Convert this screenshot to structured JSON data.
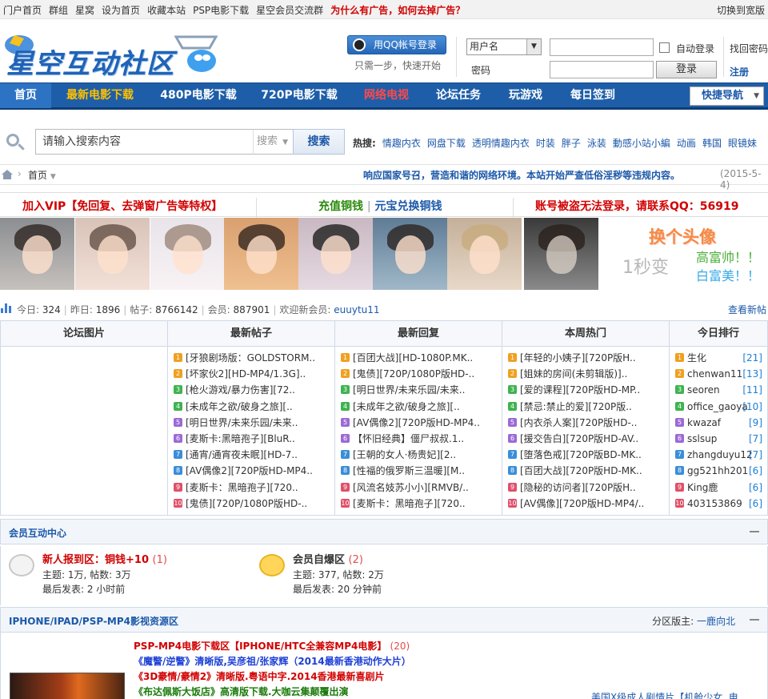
{
  "topbar": {
    "links": [
      "门户首页",
      "群组",
      "星窝",
      "设为首页",
      "收藏本站",
      "PSP电影下载",
      "星空会员交流群"
    ],
    "ad_question": "为什么有广告，如何去掉广告？",
    "wide_switch": "切换到宽版"
  },
  "header": {
    "logo_text": "星空互动社区",
    "qq_login": "用QQ帐号登录",
    "qq_note": "只需一步，快速开始",
    "username_select": "用户名",
    "password_label": "密码",
    "auto_login": "自动登录",
    "login_button": "登录",
    "find_password": "找回密码",
    "register": "注册"
  },
  "nav": {
    "items": [
      "首页",
      "最新电影下载",
      "480P电影下载",
      "720P电影下载",
      "网络电视",
      "论坛任务",
      "玩游戏",
      "每日签到"
    ],
    "quick": "快捷导航"
  },
  "search": {
    "placeholder": "请输入搜索内容",
    "type": "搜索",
    "button": "搜索",
    "hot_label": "热搜:",
    "hot_terms": [
      "情趣内衣",
      "网盘下载",
      "透明情趣内衣",
      "时装",
      "胖子",
      "泳装",
      "動感小站小編",
      "动画",
      "韩国",
      "眼镜妹"
    ]
  },
  "breadcrumb": {
    "current": "首页",
    "notice": "响应国家号召，营造和谐的网络环境。本站开始严查低俗淫秽等违规内容。",
    "date": "(2015-5-4)"
  },
  "banners": {
    "vip": "加入VIP【免回复、去弹窗广告等特权】",
    "recharge": "充值铜钱",
    "exchange": "元宝兑换铜钱",
    "stolen": "账号被盗无法登录，请联系QQ：56919"
  },
  "avatar_ad": {
    "title": "换个头像",
    "sub": "1秒变",
    "line1": "高富帅！！",
    "line2": "白富美！！"
  },
  "stats": {
    "today_label": "今日:",
    "today": "324",
    "yesterday_label": "昨日:",
    "yesterday": "1896",
    "posts_label": "帖子:",
    "posts": "8766142",
    "members_label": "会员:",
    "members": "887901",
    "welcome_label": "欢迎新会员:",
    "new_member": "euuytu11",
    "view_new": "查看新帖"
  },
  "columns": [
    {
      "title": "论坛图片",
      "items": []
    },
    {
      "title": "最新帖子",
      "items": [
        "[牙狼剧场版：GOLDSTORM..",
        "[坏家伙2][HD-MP4/1.3G]..",
        "[枪火游戏/暴力伤害][72..",
        "[未成年之欲/破身之旅][..",
        "[明日世界/未来乐园/未来..",
        "[麦斯卡:黑暗孢子][BluR..",
        "[通宵/通宵夜未眠][HD-7..",
        "[AV偶像2][720P版HD-MP4..",
        "[麦斯卡：黑暗孢子][720..",
        "[鬼债][720P/1080P版HD-.."
      ]
    },
    {
      "title": "最新回复",
      "items": [
        "[百团大战][HD-1080P.MK..",
        "[鬼债][720P/1080P版HD-..",
        "[明日世界/未来乐园/未来..",
        "[未成年之欲/破身之旅][..",
        "[AV偶像2][720P版HD-MP4..",
        "【怀旧经典】僵尸叔叔.1..",
        "[王朝的女人·杨贵妃][2..",
        "[性福的俄罗斯三温暖][M..",
        "[风流名妓苏小小][RMVB/..",
        "[麦斯卡：黑暗孢子][720.."
      ]
    },
    {
      "title": "本周热门",
      "items": [
        "[年轻的小姨子][720P版H..",
        "[姐妹的房间(未剪辑版)]..",
        "[爱的课程][720P版HD-MP..",
        "[禁忌:禁止的爱][720P版..",
        "[内衣杀人案][720P版HD-..",
        "[援交告白][720P版HD-AV..",
        "[堕落色戒][720P版BD-MK..",
        "[百团大战][720P版HD-MK..",
        "[隐秘的访问者][720P版H..",
        "[AV偶像][720P版HD-MP4/.."
      ]
    },
    {
      "title": "今日排行",
      "items": [
        "生化",
        "chenwan11",
        "seoren",
        "office_gaoya",
        "kwazaf",
        "sslsup",
        "zhangduyu12",
        "gg521hh201",
        "King鹿",
        "403153869"
      ],
      "values": [
        "21",
        "13",
        "11",
        "10",
        "9",
        "7",
        "7",
        "6",
        "6",
        "6"
      ]
    }
  ],
  "rank_badge_colors": [
    "#f0a020",
    "#f0a020",
    "#3fb34f",
    "#3fb34f",
    "#9c6ad6",
    "#9c6ad6",
    "#3a8ed8",
    "#3a8ed8",
    "#e0506a",
    "#e0506a"
  ],
  "section1": {
    "title": "会员互动中心",
    "forums": [
      {
        "name": "新人报到区：铜钱+10",
        "count": "(1)",
        "stats": "主题: 1万, 帖数: 3万",
        "last": "最后发表: 2 小时前"
      },
      {
        "name": "会员自爆区",
        "count": "(2)",
        "stats": "主题: 377, 帖数: 2万",
        "last": "最后发表: 20 分钟前"
      }
    ]
  },
  "section2": {
    "title": "IPHONE/IPAD/PSP-MP4影视资源区",
    "moderator_label": "分区版主:",
    "moderator": "一鹿向北",
    "forum_title": "PSP-MP4电影下载区【IPHONE/HTC全兼容MP4电影】",
    "forum_count": "(20)",
    "lines": [
      "《魔警/逆警》清晰版,吴彦祖/张家辉（2014最新香港动作大片）",
      "《3D豪情/豪情2》清晰版.粤语中字.2014香港最新喜剧片",
      "《布达佩斯大饭店》高清版下载.大咖云集颠覆出演"
    ],
    "latest": "美国X级成人剧情片【机舱少女. 电"
  }
}
